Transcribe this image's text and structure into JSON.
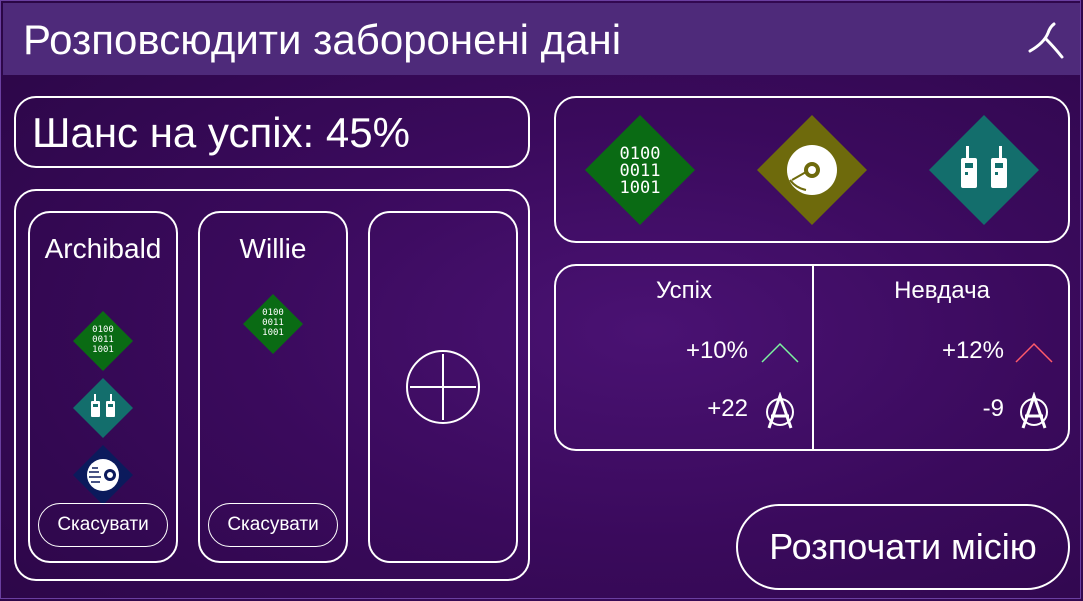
{
  "window": {
    "title": "Розповсюдити заборонені дані"
  },
  "chance": {
    "label": "Шанс на успіх: 45%",
    "value_percent": 45
  },
  "team": {
    "agents": [
      {
        "name": "Archibald",
        "skills": [
          "data-hacking-icon",
          "radio-comms-icon",
          "cyber-eye-icon"
        ],
        "cancel_label": "Скасувати"
      },
      {
        "name": "Willie",
        "skills": [
          "data-hacking-icon"
        ],
        "cancel_label": "Скасувати"
      }
    ],
    "add_slot_icon": "add-agent-icon"
  },
  "requirements": {
    "icons": [
      "data-hacking-icon",
      "disc-icon",
      "radio-comms-icon"
    ],
    "binary_text": [
      "0100",
      "0011",
      "1001"
    ],
    "colors": {
      "data": "#0a6b14",
      "disc": "#6e6a0c",
      "radio": "#136e6c",
      "eye": "#0b1a5c"
    }
  },
  "outcome": {
    "success": {
      "title": "Успіх",
      "chance_change": "+10%",
      "notoriety_change": "+22",
      "arrow_color": "#7cf5a0"
    },
    "failure": {
      "title": "Невдача",
      "chance_change": "+12%",
      "notoriety_change": "-9",
      "arrow_color": "#ff5a6a"
    }
  },
  "actions": {
    "start_label": "Розпочати місію"
  }
}
